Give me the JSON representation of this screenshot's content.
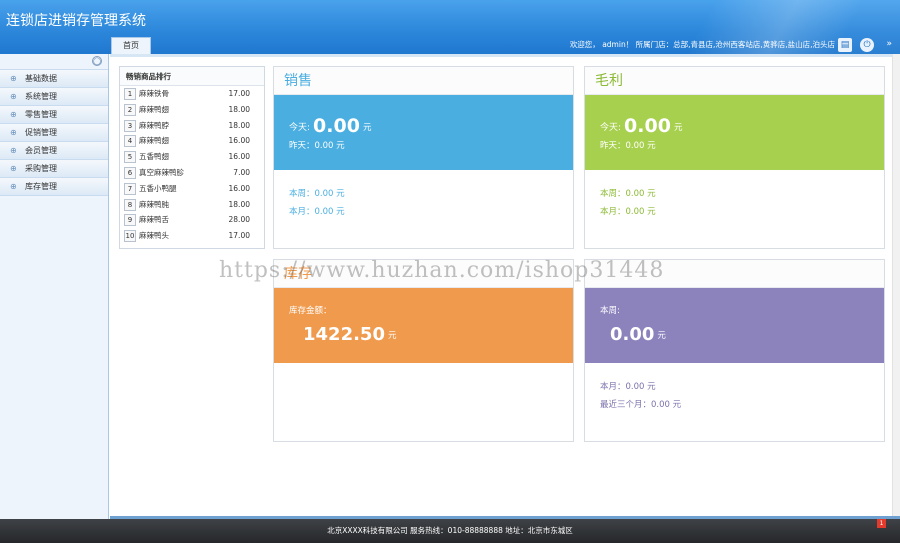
{
  "header": {
    "title": "连锁店进销存管理系统",
    "home_tab": "首页",
    "user_text": "欢迎您， admin！ 所属门店：总部,青县店,沧州西客站店,黄骅店,盐山店,泊头店"
  },
  "sidebar": {
    "items": [
      {
        "label": "基础数据"
      },
      {
        "label": "系统管理"
      },
      {
        "label": "零售管理"
      },
      {
        "label": "促销管理"
      },
      {
        "label": "会员管理"
      },
      {
        "label": "采购管理"
      },
      {
        "label": "库存管理"
      }
    ]
  },
  "ranking": {
    "title": "畅销商品排行",
    "rows": [
      {
        "no": "1",
        "name": "麻辣铁骨",
        "value": "17.00"
      },
      {
        "no": "2",
        "name": "麻辣鸭翅",
        "value": "18.00"
      },
      {
        "no": "3",
        "name": "麻辣鸭脖",
        "value": "18.00"
      },
      {
        "no": "4",
        "name": "麻辣鸭翅",
        "value": "16.00"
      },
      {
        "no": "5",
        "name": "五香鸭翅",
        "value": "16.00"
      },
      {
        "no": "6",
        "name": "真空麻辣鸭胗",
        "value": "7.00"
      },
      {
        "no": "7",
        "name": "五香小鸭腿",
        "value": "16.00"
      },
      {
        "no": "8",
        "name": "麻辣鸭肫",
        "value": "18.00"
      },
      {
        "no": "9",
        "name": "麻辣鸭舌",
        "value": "28.00"
      },
      {
        "no": "10",
        "name": "麻辣鸭头",
        "value": "17.00"
      }
    ]
  },
  "sales": {
    "title": "销售",
    "today_label": "今天:",
    "today_value": "0.00",
    "unit": "元",
    "yesterday": "昨天：0.00 元",
    "week": "本周：0.00 元",
    "month": "本月：0.00 元"
  },
  "profit": {
    "title": "毛利",
    "today_label": "今天:",
    "today_value": "0.00",
    "unit": "元",
    "yesterday": "昨天：0.00 元",
    "week": "本周：0.00 元",
    "month": "本月：0.00 元"
  },
  "inventory": {
    "title": "库存",
    "amount_label": "库存金额：",
    "amount_value": "1422.50",
    "unit": "元"
  },
  "purchase": {
    "week_label": "本周:",
    "week_value": "0.00",
    "unit": "元",
    "month": "本月：0.00 元",
    "three_months": "最近三个月：0.00 元"
  },
  "footer": {
    "text": "北京XXXX科技有限公司 服务热线：010-88888888 地址：北京市东城区",
    "badge": "1"
  },
  "watermark": "https://www.huzhan.com/ishop31448",
  "colors": {
    "header_blue": "#2b86da",
    "sales_blue": "#4aaee0",
    "profit_green": "#a8d04f",
    "inventory_orange": "#ef9a4c",
    "purchase_purple": "#8c83bd"
  }
}
